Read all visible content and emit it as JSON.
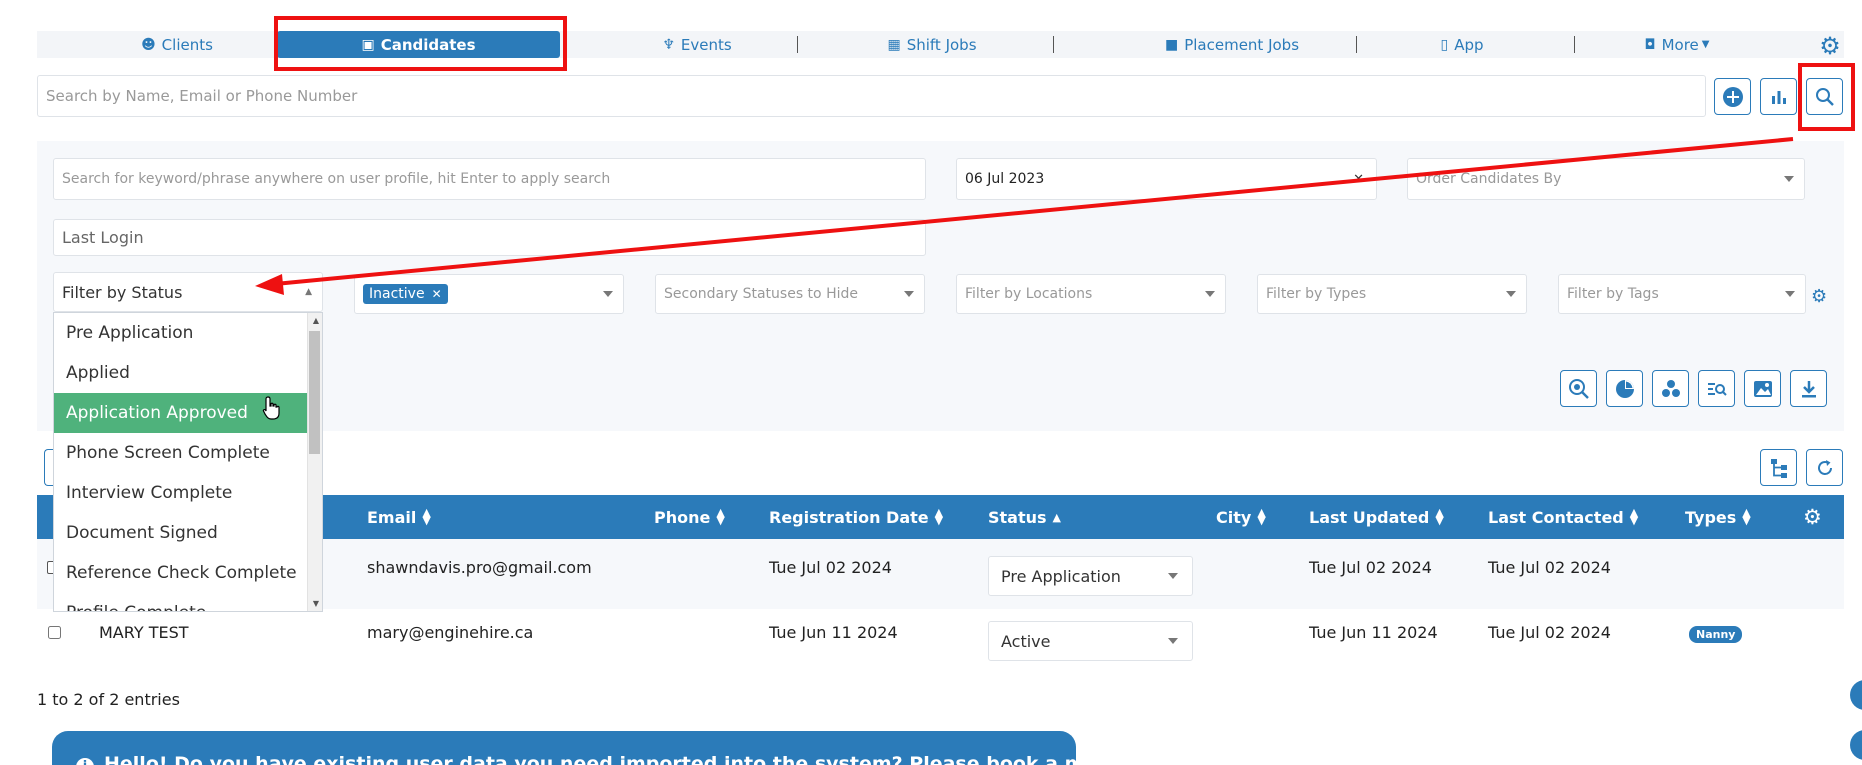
{
  "nav": {
    "tabs": [
      {
        "label": "Clients",
        "icon": "palette-icon"
      },
      {
        "label": "Candidates",
        "icon": "id-badge-icon"
      },
      {
        "label": "Events",
        "icon": "trophy-icon"
      },
      {
        "label": "Shift Jobs",
        "icon": "calendar-icon"
      },
      {
        "label": "Placement Jobs",
        "icon": "briefcase-icon"
      },
      {
        "label": "App",
        "icon": "mobile-icon"
      },
      {
        "label": "More",
        "icon": "tag-icon"
      }
    ],
    "active_tab": "Candidates"
  },
  "search": {
    "placeholder": "Search by Name, Email or Phone Number"
  },
  "filters": {
    "keyword_placeholder": "Search for keyword/phrase anywhere on user profile, hit Enter to apply search",
    "date_value": "06 Jul 2023",
    "order_placeholder": "Order Candidates By",
    "last_login_placeholder": "Last Login",
    "status_placeholder": "Filter by Status",
    "selected_tag": "Inactive",
    "secondary_placeholder": "Secondary Statuses to Hide",
    "locations_placeholder": "Filter by Locations",
    "types_placeholder": "Filter by Types",
    "tags_placeholder": "Filter by Tags"
  },
  "status_options": [
    "Pre Application",
    "Applied",
    "Application Approved",
    "Phone Screen Complete",
    "Interview Complete",
    "Document Signed",
    "Reference Check Complete",
    "Profile Complete"
  ],
  "highlighted_option": "Application Approved",
  "table": {
    "columns": [
      "Email",
      "Phone",
      "Registration Date",
      "Status",
      "City",
      "Last Updated",
      "Last Contacted",
      "Types"
    ],
    "rows": [
      {
        "name": "",
        "email": "shawndavis.pro@gmail.com",
        "phone": "",
        "registration": "Tue Jul 02 2024",
        "status": "Pre Application",
        "city": "",
        "updated": "Tue Jul 02 2024",
        "contacted": "Tue Jul 02 2024",
        "types": ""
      },
      {
        "name": "MARY TEST",
        "email": "mary@enginehire.ca",
        "phone": "",
        "registration": "Tue Jun 11 2024",
        "status": "Active",
        "city": "",
        "updated": "Tue Jun 11 2024",
        "contacted": "Tue Jul 02 2024",
        "types": "Nanny"
      }
    ]
  },
  "entries_text": "1 to 2 of 2 entries",
  "banner_text": "Hello! Do you have existing user data you need imported into the system? Please book a meeting to",
  "colors": {
    "primary": "#2b7bb9",
    "highlight": "#4fb27c",
    "annotation": "#ee1111"
  }
}
